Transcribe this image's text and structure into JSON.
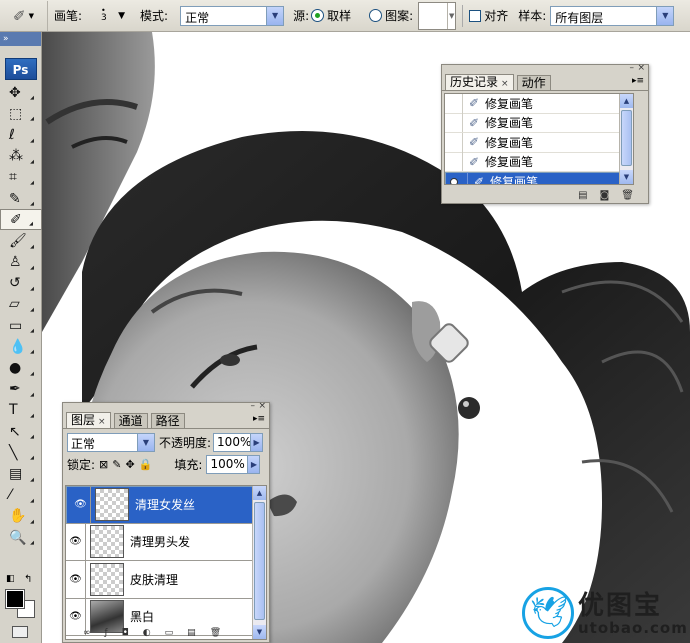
{
  "options_bar": {
    "brush_label": "画笔:",
    "brush_size": "3",
    "mode_label": "模式:",
    "mode_value": "正常",
    "source_label": "源:",
    "sampled_label": "取样",
    "pattern_label": "图案:",
    "aligned_label": "对齐",
    "sample_label": "样本:",
    "sample_value": "所有图层"
  },
  "toolbox": {
    "logo": "Ps",
    "collapse": "»",
    "tools": [
      {
        "icon": "move-icon",
        "glyph": "✥"
      },
      {
        "icon": "marquee-icon",
        "glyph": "⬚"
      },
      {
        "icon": "lasso-icon",
        "glyph": "ℓ"
      },
      {
        "icon": "magic-wand-icon",
        "glyph": "⁂"
      },
      {
        "icon": "crop-icon",
        "glyph": "⌗"
      },
      {
        "icon": "slice-icon",
        "glyph": "✎"
      },
      {
        "icon": "healing-brush-icon",
        "glyph": "✐"
      },
      {
        "icon": "brush-icon",
        "glyph": "🖌"
      },
      {
        "icon": "clone-stamp-icon",
        "glyph": "♙"
      },
      {
        "icon": "history-brush-icon",
        "glyph": "↺"
      },
      {
        "icon": "eraser-icon",
        "glyph": "▱"
      },
      {
        "icon": "gradient-icon",
        "glyph": "▭"
      },
      {
        "icon": "blur-icon",
        "glyph": "💧"
      },
      {
        "icon": "dodge-icon",
        "glyph": "●"
      },
      {
        "icon": "pen-icon",
        "glyph": "✒"
      },
      {
        "icon": "type-icon",
        "glyph": "T"
      },
      {
        "icon": "path-select-icon",
        "glyph": "↖"
      },
      {
        "icon": "line-icon",
        "glyph": "╲"
      },
      {
        "icon": "notes-icon",
        "glyph": "▤"
      },
      {
        "icon": "eyedropper-icon",
        "glyph": "⁄"
      },
      {
        "icon": "hand-icon",
        "glyph": "✋"
      },
      {
        "icon": "zoom-icon",
        "glyph": "🔍"
      }
    ]
  },
  "history_panel": {
    "tabs": [
      "历史记录",
      "动作"
    ],
    "items": [
      "修复画笔",
      "修复画笔",
      "修复画笔",
      "修复画笔",
      "修复画笔"
    ],
    "selected_index": 4
  },
  "layers_panel": {
    "tabs": [
      "图层",
      "通道",
      "路径"
    ],
    "blend_mode": "正常",
    "opacity_label": "不透明度:",
    "opacity_value": "100%",
    "lock_label": "锁定:",
    "fill_label": "填充:",
    "fill_value": "100%",
    "layers": [
      {
        "name": "清理女发丝",
        "thumb": "transparent"
      },
      {
        "name": "清理男头发",
        "thumb": "transparent"
      },
      {
        "name": "皮肤清理",
        "thumb": "transparent"
      },
      {
        "name": "黑白",
        "thumb": "photo"
      }
    ],
    "selected_index": 0
  },
  "watermark": {
    "cn": "优图宝",
    "en": "utobao.com"
  }
}
